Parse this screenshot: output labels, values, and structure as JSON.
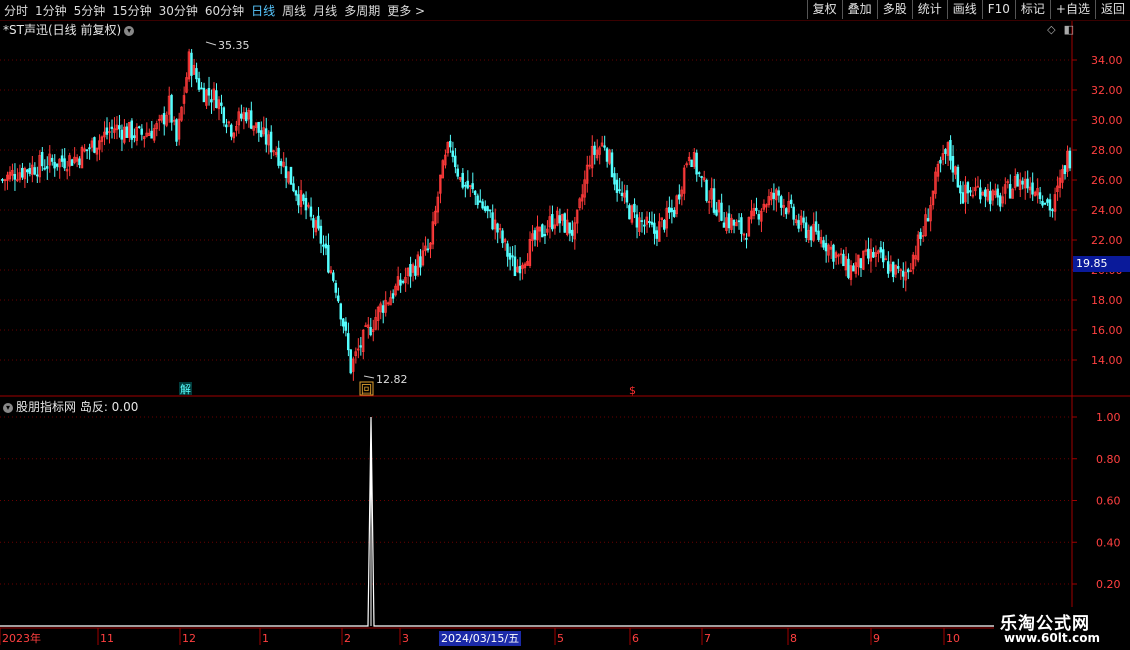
{
  "toolbar": {
    "periods": [
      "分时",
      "1分钟",
      "5分钟",
      "15分钟",
      "30分钟",
      "60分钟",
      "日线",
      "周线",
      "月线",
      "多周期",
      "更多 >"
    ],
    "active_period": "日线",
    "actions": [
      "复权",
      "叠加",
      "多股",
      "统计",
      "画线",
      "F10",
      "标记",
      "+自选",
      "返回"
    ]
  },
  "main_chart": {
    "title": "*ST声迅(日线 前复权)",
    "high_label": "35.35",
    "low_label": "12.82",
    "current_price": "19.85",
    "markers": [
      "解",
      "回",
      "$"
    ],
    "y_ticks": [
      "34.00",
      "32.00",
      "30.00",
      "28.00",
      "26.00",
      "24.00",
      "22.00",
      "20.00",
      "18.00",
      "16.00",
      "14.00"
    ]
  },
  "indicator": {
    "title": "股朋指标网 岛反: 0.00",
    "y_ticks": [
      "1.00",
      "0.80",
      "0.60",
      "0.40",
      "0.20"
    ]
  },
  "date_axis": {
    "labels": [
      "2023年",
      "11",
      "12",
      "1",
      "2",
      "3",
      "5",
      "6",
      "7",
      "8",
      "9",
      "10"
    ],
    "highlight": "2024/03/15/五"
  },
  "watermark": {
    "name": "乐淘公式网",
    "url": "www.60lt.com"
  },
  "colors": {
    "up": "#ff3a3a",
    "down": "#54ffff",
    "grid": "#7a0000",
    "axis": "#a00000",
    "price_tag": "#0a1a9a"
  },
  "chart_data": {
    "type": "candlestick",
    "ylim": [
      12,
      36
    ],
    "anchors": [
      [
        0,
        26
      ],
      [
        5,
        26.5
      ],
      [
        15,
        27
      ],
      [
        30,
        27.5
      ],
      [
        45,
        29.5
      ],
      [
        55,
        29
      ],
      [
        63,
        29.5
      ],
      [
        67,
        31
      ],
      [
        70,
        28.5
      ],
      [
        75,
        34
      ],
      [
        80,
        32
      ],
      [
        86,
        31.5
      ],
      [
        92,
        29.5
      ],
      [
        98,
        30.5
      ],
      [
        104,
        29
      ],
      [
        110,
        28
      ],
      [
        116,
        26
      ],
      [
        122,
        24
      ],
      [
        128,
        22
      ],
      [
        134,
        19
      ],
      [
        137,
        16.5
      ],
      [
        140,
        13.5
      ],
      [
        144,
        15
      ],
      [
        152,
        17.5
      ],
      [
        162,
        19.5
      ],
      [
        172,
        21.5
      ],
      [
        176,
        26
      ],
      [
        180,
        28.5
      ],
      [
        184,
        26
      ],
      [
        190,
        25
      ],
      [
        198,
        23
      ],
      [
        206,
        20
      ],
      [
        214,
        22
      ],
      [
        222,
        23.5
      ],
      [
        230,
        22.5
      ],
      [
        236,
        27.5
      ],
      [
        242,
        28.5
      ],
      [
        248,
        25
      ],
      [
        254,
        23.5
      ],
      [
        262,
        22.5
      ],
      [
        270,
        24
      ],
      [
        276,
        28
      ],
      [
        282,
        25.5
      ],
      [
        290,
        23.5
      ],
      [
        298,
        22.5
      ],
      [
        306,
        24.5
      ],
      [
        312,
        25
      ],
      [
        320,
        23
      ],
      [
        330,
        22
      ],
      [
        340,
        20
      ],
      [
        350,
        21
      ],
      [
        358,
        20
      ],
      [
        362,
        19.5
      ],
      [
        370,
        22.5
      ],
      [
        376,
        26.5
      ],
      [
        380,
        28
      ],
      [
        386,
        25
      ],
      [
        394,
        25.5
      ],
      [
        400,
        24.5
      ],
      [
        408,
        26
      ],
      [
        416,
        25.5
      ],
      [
        422,
        24
      ],
      [
        428,
        27.5
      ]
    ],
    "bars": 430,
    "indicator_spike": {
      "value": 1.0,
      "date": "2024/03/15"
    },
    "indicator_ylim": [
      0,
      1.1
    ]
  }
}
